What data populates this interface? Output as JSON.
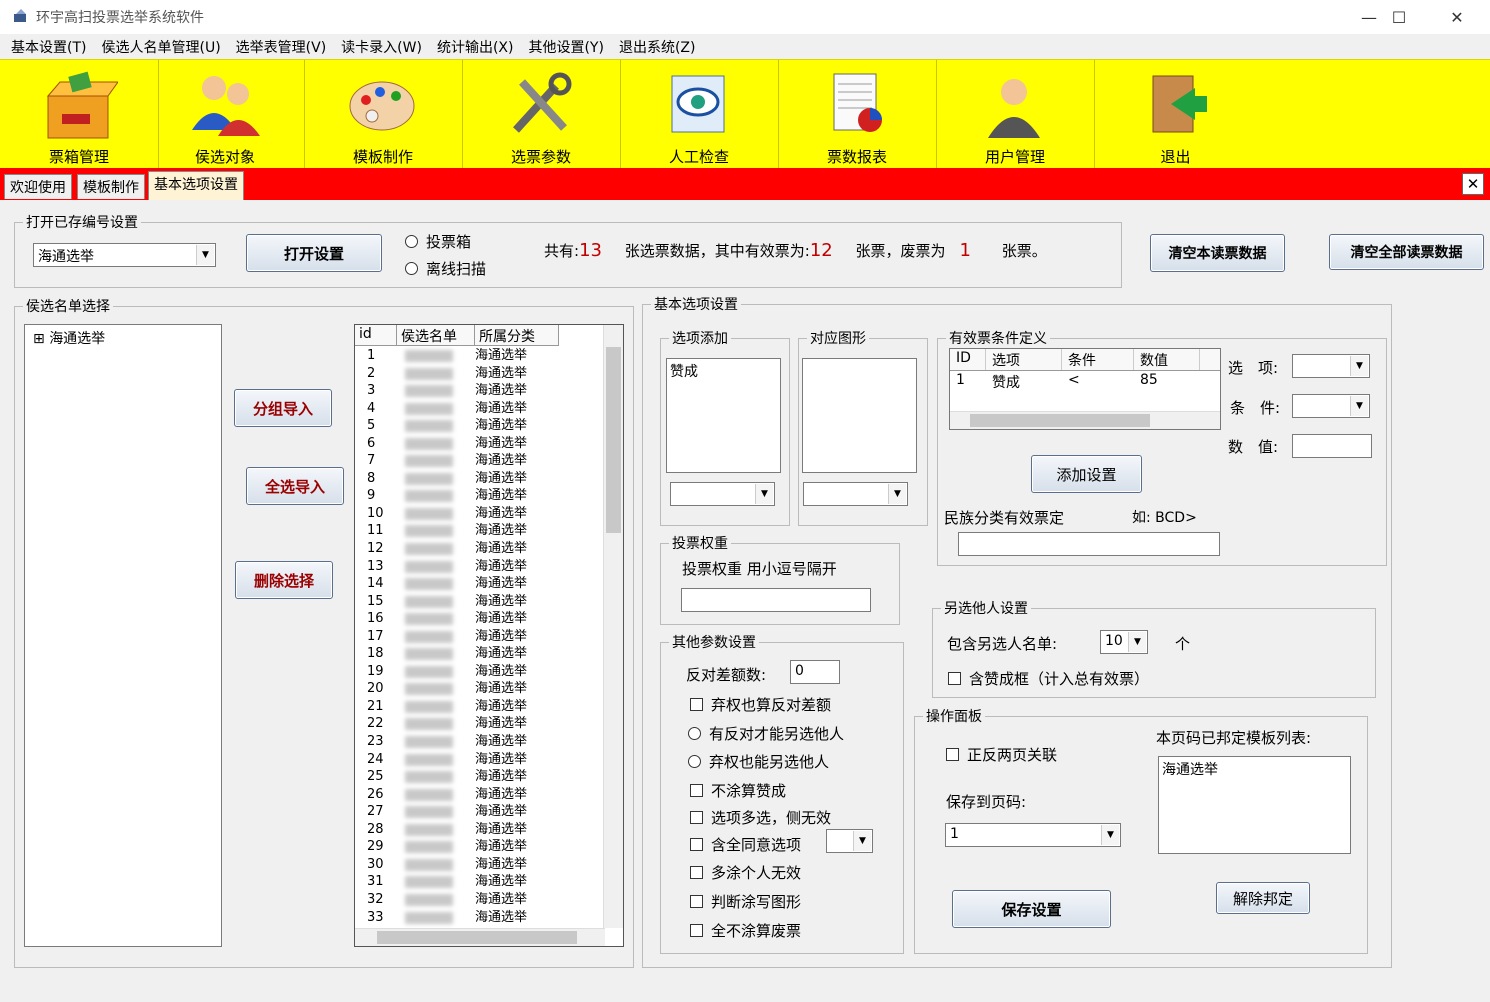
{
  "window": {
    "title": "环宇高扫投票选举系统软件",
    "min": "—",
    "max": "☐",
    "close": "✕"
  },
  "menu": [
    "基本设置(T)",
    "侯选人名单管理(U)",
    "选举表管理(V)",
    "读卡录入(W)",
    "统计输出(X)",
    "其他设置(Y)",
    "退出系统(Z)"
  ],
  "toolbar": [
    {
      "label": "票箱管理",
      "icon": "ballot-box-icon"
    },
    {
      "label": "侯选对象",
      "icon": "users-icon"
    },
    {
      "label": "模板制作",
      "icon": "palette-icon"
    },
    {
      "label": "选票参数",
      "icon": "tools-icon"
    },
    {
      "label": "人工检查",
      "icon": "eye-icon"
    },
    {
      "label": "票数报表",
      "icon": "report-icon"
    },
    {
      "label": "用户管理",
      "icon": "user-icon"
    },
    {
      "label": "退出",
      "icon": "exit-icon"
    }
  ],
  "tabs": [
    "欢迎使用",
    "模板制作",
    "基本选项设置"
  ],
  "tab_close": "✕",
  "open_settings": {
    "legend": "打开已存编号设置",
    "selected": "海通选举",
    "open_button": "打开设置",
    "radio_box": "投票箱",
    "radio_offline": "离线扫描",
    "summary_prefix": "共有:",
    "total": "13",
    "summary_mid": "张选票数据，其中有效票为:",
    "valid": "12",
    "summary_mid2": "张票，废票为",
    "invalid": "1",
    "summary_end": "张票。",
    "clear_this": "清空本读票数据",
    "clear_all": "清空全部读票数据"
  },
  "candidate_list": {
    "legend": "侯选名单选择",
    "tree_expand": "⊞",
    "tree_item": "海通选举",
    "btn_group": "分组导入",
    "btn_all": "全选导入",
    "btn_delete": "删除选择",
    "headers": [
      "id",
      "侯选名单",
      "所属分类"
    ],
    "rows": [
      {
        "id": "1",
        "cat": "海通选举"
      },
      {
        "id": "2",
        "cat": "海通选举"
      },
      {
        "id": "3",
        "cat": "海通选举"
      },
      {
        "id": "4",
        "cat": "海通选举"
      },
      {
        "id": "5",
        "cat": "海通选举"
      },
      {
        "id": "6",
        "cat": "海通选举"
      },
      {
        "id": "7",
        "cat": "海通选举"
      },
      {
        "id": "8",
        "cat": "海通选举"
      },
      {
        "id": "9",
        "cat": "海通选举"
      },
      {
        "id": "10",
        "cat": "海通选举"
      },
      {
        "id": "11",
        "cat": "海通选举"
      },
      {
        "id": "12",
        "cat": "海通选举"
      },
      {
        "id": "13",
        "cat": "海通选举"
      },
      {
        "id": "14",
        "cat": "海通选举"
      },
      {
        "id": "15",
        "cat": "海通选举"
      },
      {
        "id": "16",
        "cat": "海通选举"
      },
      {
        "id": "17",
        "cat": "海通选举"
      },
      {
        "id": "18",
        "cat": "海通选举"
      },
      {
        "id": "19",
        "cat": "海通选举"
      },
      {
        "id": "20",
        "cat": "海通选举"
      },
      {
        "id": "21",
        "cat": "海通选举"
      },
      {
        "id": "22",
        "cat": "海通选举"
      },
      {
        "id": "23",
        "cat": "海通选举"
      },
      {
        "id": "24",
        "cat": "海通选举"
      },
      {
        "id": "25",
        "cat": "海通选举"
      },
      {
        "id": "26",
        "cat": "海通选举"
      },
      {
        "id": "27",
        "cat": "海通选举"
      },
      {
        "id": "28",
        "cat": "海通选举"
      },
      {
        "id": "29",
        "cat": "海通选举"
      },
      {
        "id": "30",
        "cat": "海通选举"
      },
      {
        "id": "31",
        "cat": "海通选举"
      },
      {
        "id": "32",
        "cat": "海通选举"
      },
      {
        "id": "33",
        "cat": "海通选举"
      }
    ]
  },
  "basic": {
    "legend": "基本选项设置",
    "option_add_legend": "选项添加",
    "option_item": "赞成",
    "shape_legend": "对应图形",
    "valid_legend": "有效票条件定义",
    "valid_headers": [
      "ID",
      "选项",
      "条件",
      "数值"
    ],
    "valid_row": [
      "1",
      "赞成",
      "<",
      "85"
    ],
    "opt_label": "选　项:",
    "cond_label": "条　件:",
    "value_label": "数　值:",
    "add_button": "添加设置",
    "ethnic_label": "民族分类有效票定",
    "ethnic_hint": "如: BCD>",
    "weight_legend": "投票权重",
    "weight_label": "投票权重 用小逗号隔开",
    "other_legend": "其他参数设置",
    "against_label": "反对差额数:",
    "against_value": "0",
    "cb1": "弃权也算反对差额",
    "r1": "有反对才能另选他人",
    "r2": "弃权也能另选他人",
    "cb2": "不涂算赞成",
    "cb3": "选项多选，侧无效",
    "cb4": "含全同意选项",
    "cb5": "多涂个人无效",
    "cb6": "判断涂写图形",
    "cb7": "全不涂算废票",
    "alt_legend": "另选他人设置",
    "alt_label": "包含另选人名单:",
    "alt_value": "10",
    "alt_unit": "个",
    "alt_cb": "含赞成框（计入总有效票）",
    "panel_legend": "操作面板",
    "panel_cb": "正反两页关联",
    "save_page_label": "保存到页码:",
    "save_page_value": "1",
    "bound_label": "本页码已邦定模板列表:",
    "bound_item": "海通选举",
    "save_button": "保存设置",
    "unbind_button": "解除邦定"
  }
}
